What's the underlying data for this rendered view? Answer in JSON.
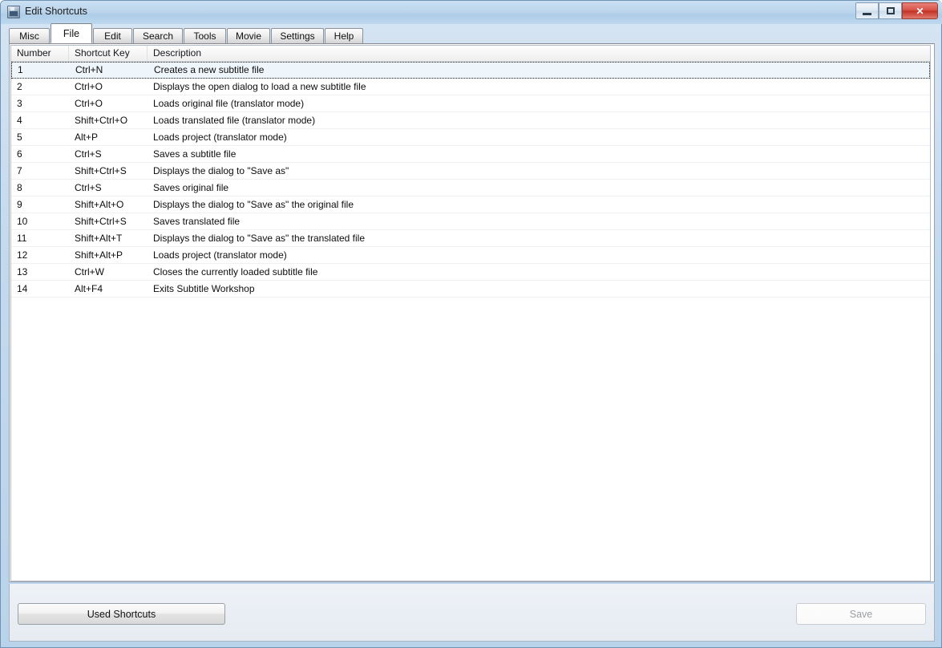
{
  "window": {
    "title": "Edit Shortcuts",
    "icon": "app-icon",
    "controls": {
      "minimize_label": "Minimize",
      "maximize_label": "Maximize",
      "close_label": "✕"
    }
  },
  "tabs": [
    {
      "label": "Misc",
      "active": false
    },
    {
      "label": "File",
      "active": true
    },
    {
      "label": "Edit",
      "active": false
    },
    {
      "label": "Search",
      "active": false
    },
    {
      "label": "Tools",
      "active": false
    },
    {
      "label": "Movie",
      "active": false
    },
    {
      "label": "Settings",
      "active": false
    },
    {
      "label": "Help",
      "active": false
    }
  ],
  "list": {
    "columns": [
      "Number",
      "Shortcut Key",
      "Description"
    ],
    "rows": [
      {
        "number": "1",
        "key": "Ctrl+N",
        "description": "Creates a new subtitle file",
        "selected": true
      },
      {
        "number": "2",
        "key": "Ctrl+O",
        "description": "Displays the open dialog to load a new subtitle file",
        "selected": false
      },
      {
        "number": "3",
        "key": "Ctrl+O",
        "description": "Loads original file (translator mode)",
        "selected": false
      },
      {
        "number": "4",
        "key": "Shift+Ctrl+O",
        "description": "Loads translated file (translator mode)",
        "selected": false
      },
      {
        "number": "5",
        "key": "Alt+P",
        "description": "Loads project (translator mode)",
        "selected": false
      },
      {
        "number": "6",
        "key": "Ctrl+S",
        "description": "Saves a subtitle file",
        "selected": false
      },
      {
        "number": "7",
        "key": "Shift+Ctrl+S",
        "description": "Displays the dialog to \"Save as\"",
        "selected": false
      },
      {
        "number": "8",
        "key": "Ctrl+S",
        "description": "Saves original file",
        "selected": false
      },
      {
        "number": "9",
        "key": "Shift+Alt+O",
        "description": "Displays the dialog to \"Save as\" the original file",
        "selected": false
      },
      {
        "number": "10",
        "key": "Shift+Ctrl+S",
        "description": "Saves translated file",
        "selected": false
      },
      {
        "number": "11",
        "key": "Shift+Alt+T",
        "description": "Displays the dialog to \"Save as\" the translated file",
        "selected": false
      },
      {
        "number": "12",
        "key": "Shift+Alt+P",
        "description": "Loads project (translator mode)",
        "selected": false
      },
      {
        "number": "13",
        "key": "Ctrl+W",
        "description": "Closes the currently loaded subtitle file",
        "selected": false
      },
      {
        "number": "14",
        "key": "Alt+F4",
        "description": "Exits Subtitle Workshop",
        "selected": false
      }
    ]
  },
  "footer": {
    "used_shortcuts_label": "Used Shortcuts",
    "save_label": "Save",
    "save_disabled": true
  },
  "colors": {
    "titlebar": "#b9d3ea",
    "close_button": "#c33226",
    "selected_row": "#eef5fb",
    "panel": "#ffffff",
    "frame": "#6f93b5"
  }
}
